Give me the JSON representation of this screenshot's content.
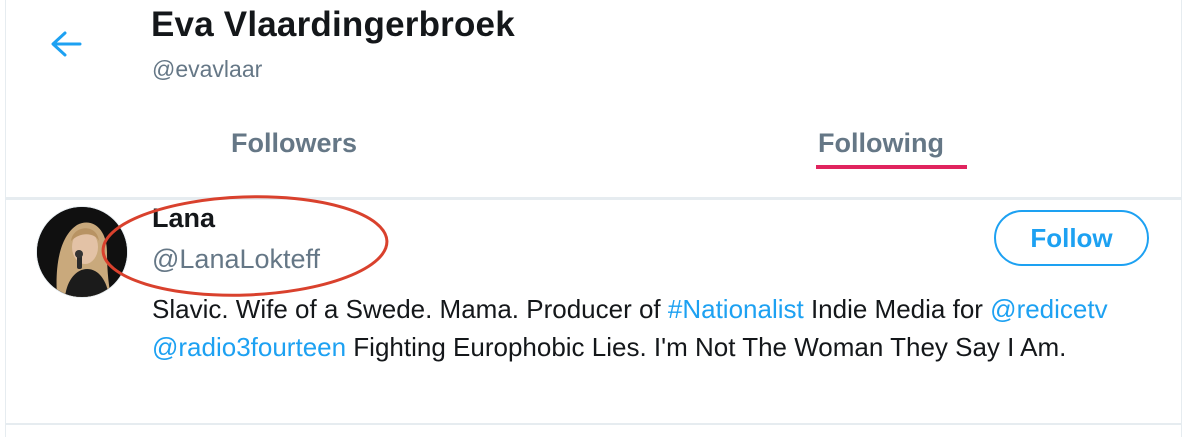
{
  "header": {
    "back_icon": "arrow-left-icon",
    "name": "Eva Vlaardingerbroek",
    "handle": "@evavlaar"
  },
  "tabs": [
    {
      "label": "Followers",
      "active": false
    },
    {
      "label": "Following",
      "active": true
    }
  ],
  "user": {
    "name": "Lana",
    "handle": "@LanaLokteff",
    "follow_label": "Follow",
    "bio": {
      "p1": "Slavic. Wife of a Swede. Mama. Producer of ",
      "hashtag": "#Nationalist",
      "p2": " Indie Media for ",
      "mention1": "@redicetv",
      "sp": " ",
      "mention2": "@radio3fourteen",
      "p3": " Fighting Europhobic Lies. I'm Not The Woman They Say I Am."
    }
  },
  "colors": {
    "accent": "#1da1f2",
    "secondary_text": "#657786",
    "tab_underline": "#e0245e",
    "annotation_ellipse": "#d9412d"
  }
}
